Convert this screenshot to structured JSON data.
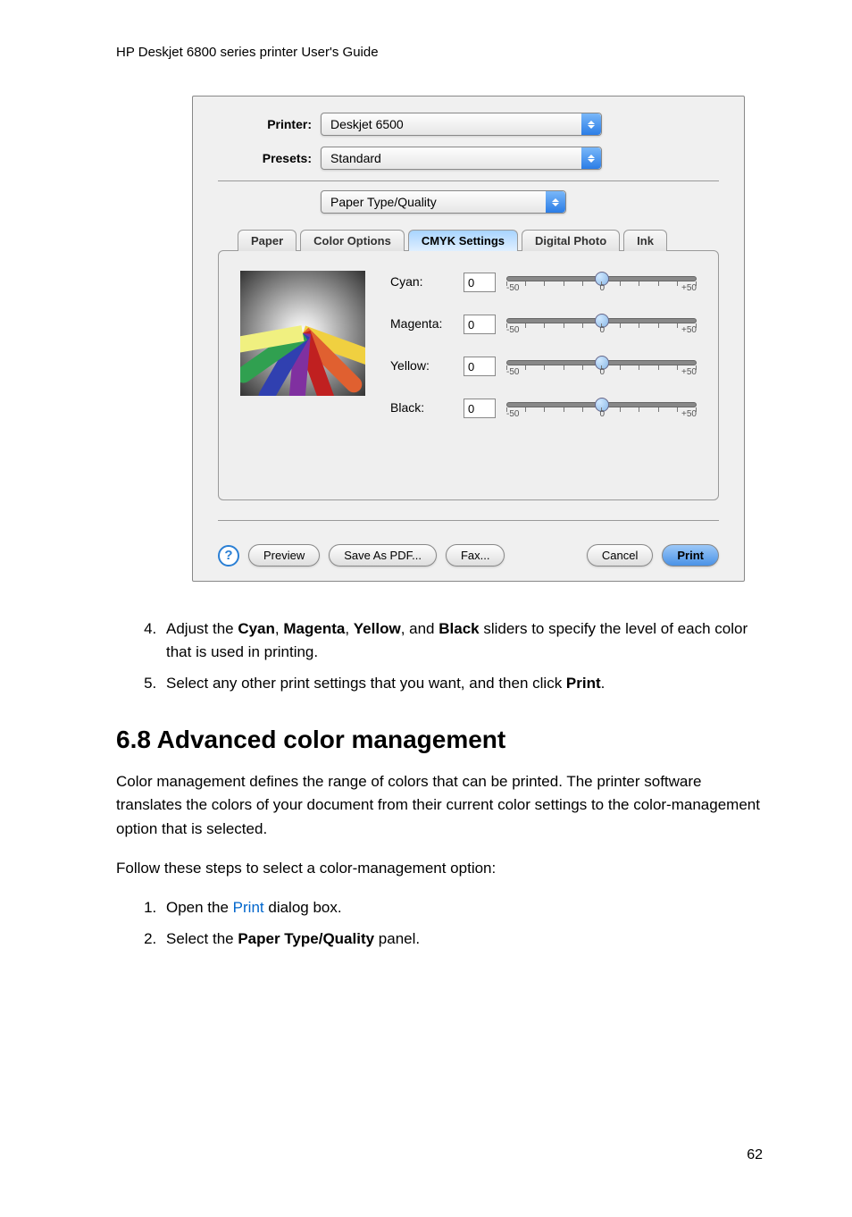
{
  "header": "HP Deskjet 6800 series printer User's Guide",
  "dialog": {
    "printer_label": "Printer:",
    "printer_value": "Deskjet 6500",
    "presets_label": "Presets:",
    "presets_value": "Standard",
    "panel_value": "Paper Type/Quality",
    "tabs": [
      "Paper",
      "Color Options",
      "CMYK Settings",
      "Digital Photo",
      "Ink"
    ],
    "sliders": [
      {
        "label": "Cyan:",
        "value": "0",
        "min": "-50",
        "mid": "0",
        "max": "+50"
      },
      {
        "label": "Magenta:",
        "value": "0",
        "min": "-50",
        "mid": "0",
        "max": "+50"
      },
      {
        "label": "Yellow:",
        "value": "0",
        "min": "-50",
        "mid": "0",
        "max": "+50"
      },
      {
        "label": "Black:",
        "value": "0",
        "min": "-50",
        "mid": "0",
        "max": "+50"
      }
    ],
    "buttons": {
      "help": "?",
      "preview": "Preview",
      "save_pdf": "Save As PDF...",
      "fax": "Fax...",
      "cancel": "Cancel",
      "print": "Print"
    }
  },
  "steps_top": {
    "n4": "4.",
    "t4a": "Adjust the ",
    "b4a": "Cyan",
    "c4a": ", ",
    "b4b": "Magenta",
    "c4b": ", ",
    "b4c": "Yellow",
    "c4c": ", and ",
    "b4d": "Black",
    "t4b": " sliders to specify the level of each color that is used in printing.",
    "n5": "5.",
    "t5a": "Select any other print settings that you want, and then click ",
    "b5a": "Print",
    "t5b": "."
  },
  "section_title": "6.8  Advanced color management",
  "para1": "Color management defines the range of colors that can be printed. The printer software translates the colors of your document from their current color settings to the color-management option that is selected.",
  "para2": "Follow these steps to select a color-management option:",
  "steps_bottom": {
    "n1": "1.",
    "t1a": "Open the ",
    "l1": "Print",
    "t1b": " dialog box.",
    "n2": "2.",
    "t2a": "Select the ",
    "b2": "Paper Type/Quality",
    "t2b": " panel."
  },
  "page_number": "62"
}
